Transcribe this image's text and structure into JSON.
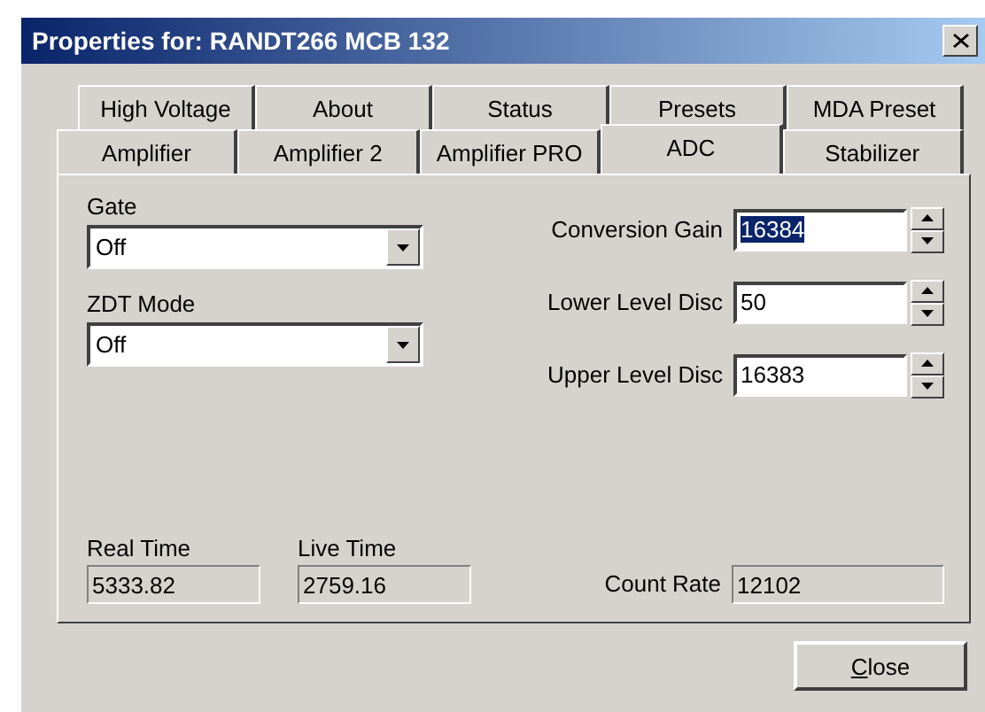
{
  "window": {
    "title": "Properties for: RANDT266 MCB 132"
  },
  "tab_rows": [
    [
      {
        "label": "High Voltage",
        "selected": false
      },
      {
        "label": "About",
        "selected": false
      },
      {
        "label": "Status",
        "selected": false
      },
      {
        "label": "Presets",
        "selected": false
      },
      {
        "label": "MDA Preset",
        "selected": false
      }
    ],
    [
      {
        "label": "Amplifier",
        "selected": false
      },
      {
        "label": "Amplifier 2",
        "selected": false
      },
      {
        "label": "Amplifier PRO",
        "selected": false
      },
      {
        "label": "ADC",
        "selected": true
      },
      {
        "label": "Stabilizer",
        "selected": false
      }
    ]
  ],
  "dropdowns": [
    {
      "label": "Gate",
      "value": "Off"
    },
    {
      "label": "ZDT Mode",
      "value": "Off"
    }
  ],
  "spinners": [
    {
      "label": "Conversion Gain",
      "value": "16384",
      "selected": true
    },
    {
      "label": "Lower Level Disc",
      "value": "50",
      "selected": false
    },
    {
      "label": "Upper Level Disc",
      "value": "16383",
      "selected": false
    }
  ],
  "readouts": [
    {
      "label": "Real Time",
      "value": "5333.82"
    },
    {
      "label": "Live Time",
      "value": "2759.16"
    }
  ],
  "count_rate": {
    "label": "Count Rate",
    "value": "12102"
  },
  "buttons": [
    "Close"
  ]
}
